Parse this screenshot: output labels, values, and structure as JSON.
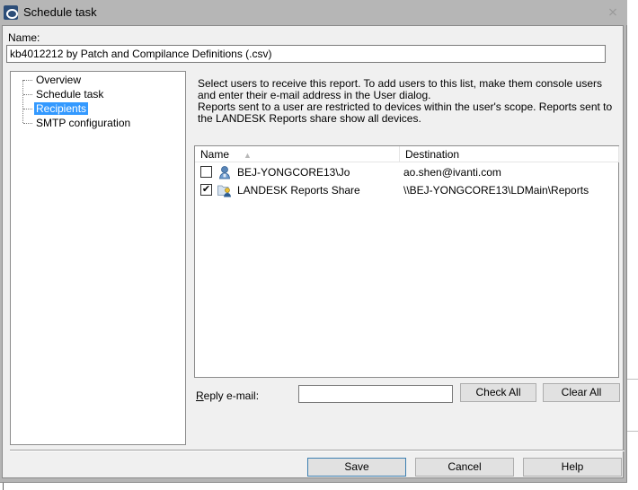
{
  "window": {
    "title": "Schedule task",
    "close_glyph": "⨯"
  },
  "name_field": {
    "label": "Name:",
    "value": "kb4012212 by Patch and Compilance Definitions (.csv)"
  },
  "tree": {
    "items": [
      {
        "label": "Overview",
        "selected": false
      },
      {
        "label": "Schedule task",
        "selected": false
      },
      {
        "label": "Recipients",
        "selected": true
      },
      {
        "label": "SMTP configuration",
        "selected": false
      }
    ]
  },
  "description": {
    "line1": "Select users to receive this report. To add users to this list, make them console users and enter their e-mail address in the User dialog.",
    "line2": "Reports sent to a user are restricted to devices within the user's scope. Reports sent to the LANDESK Reports share show all devices."
  },
  "recipients_list": {
    "columns": [
      "Name",
      "Destination"
    ],
    "sort_column": "Name",
    "sort_direction": "ascending",
    "rows": [
      {
        "checked": false,
        "icon": "user-icon",
        "name": "BEJ-YONGCORE13\\Jo",
        "destination": "ao.shen@ivanti.com"
      },
      {
        "checked": true,
        "icon": "shared-folder-user-icon",
        "name": "LANDESK Reports Share",
        "destination": "\\\\BEJ-YONGCORE13\\LDMain\\Reports"
      }
    ]
  },
  "reply_email": {
    "label_accel": "R",
    "label_rest": "eply e-mail:",
    "value": ""
  },
  "buttons": {
    "check_all": "Check All",
    "clear_all": "Clear All",
    "save": "Save",
    "cancel": "Cancel",
    "help": "Help"
  },
  "colors": {
    "selection": "#3399ff",
    "titlebar": "#b6b6b6",
    "dialog_bg": "#f0f0f0",
    "default_button_border": "#3c7fb1"
  }
}
